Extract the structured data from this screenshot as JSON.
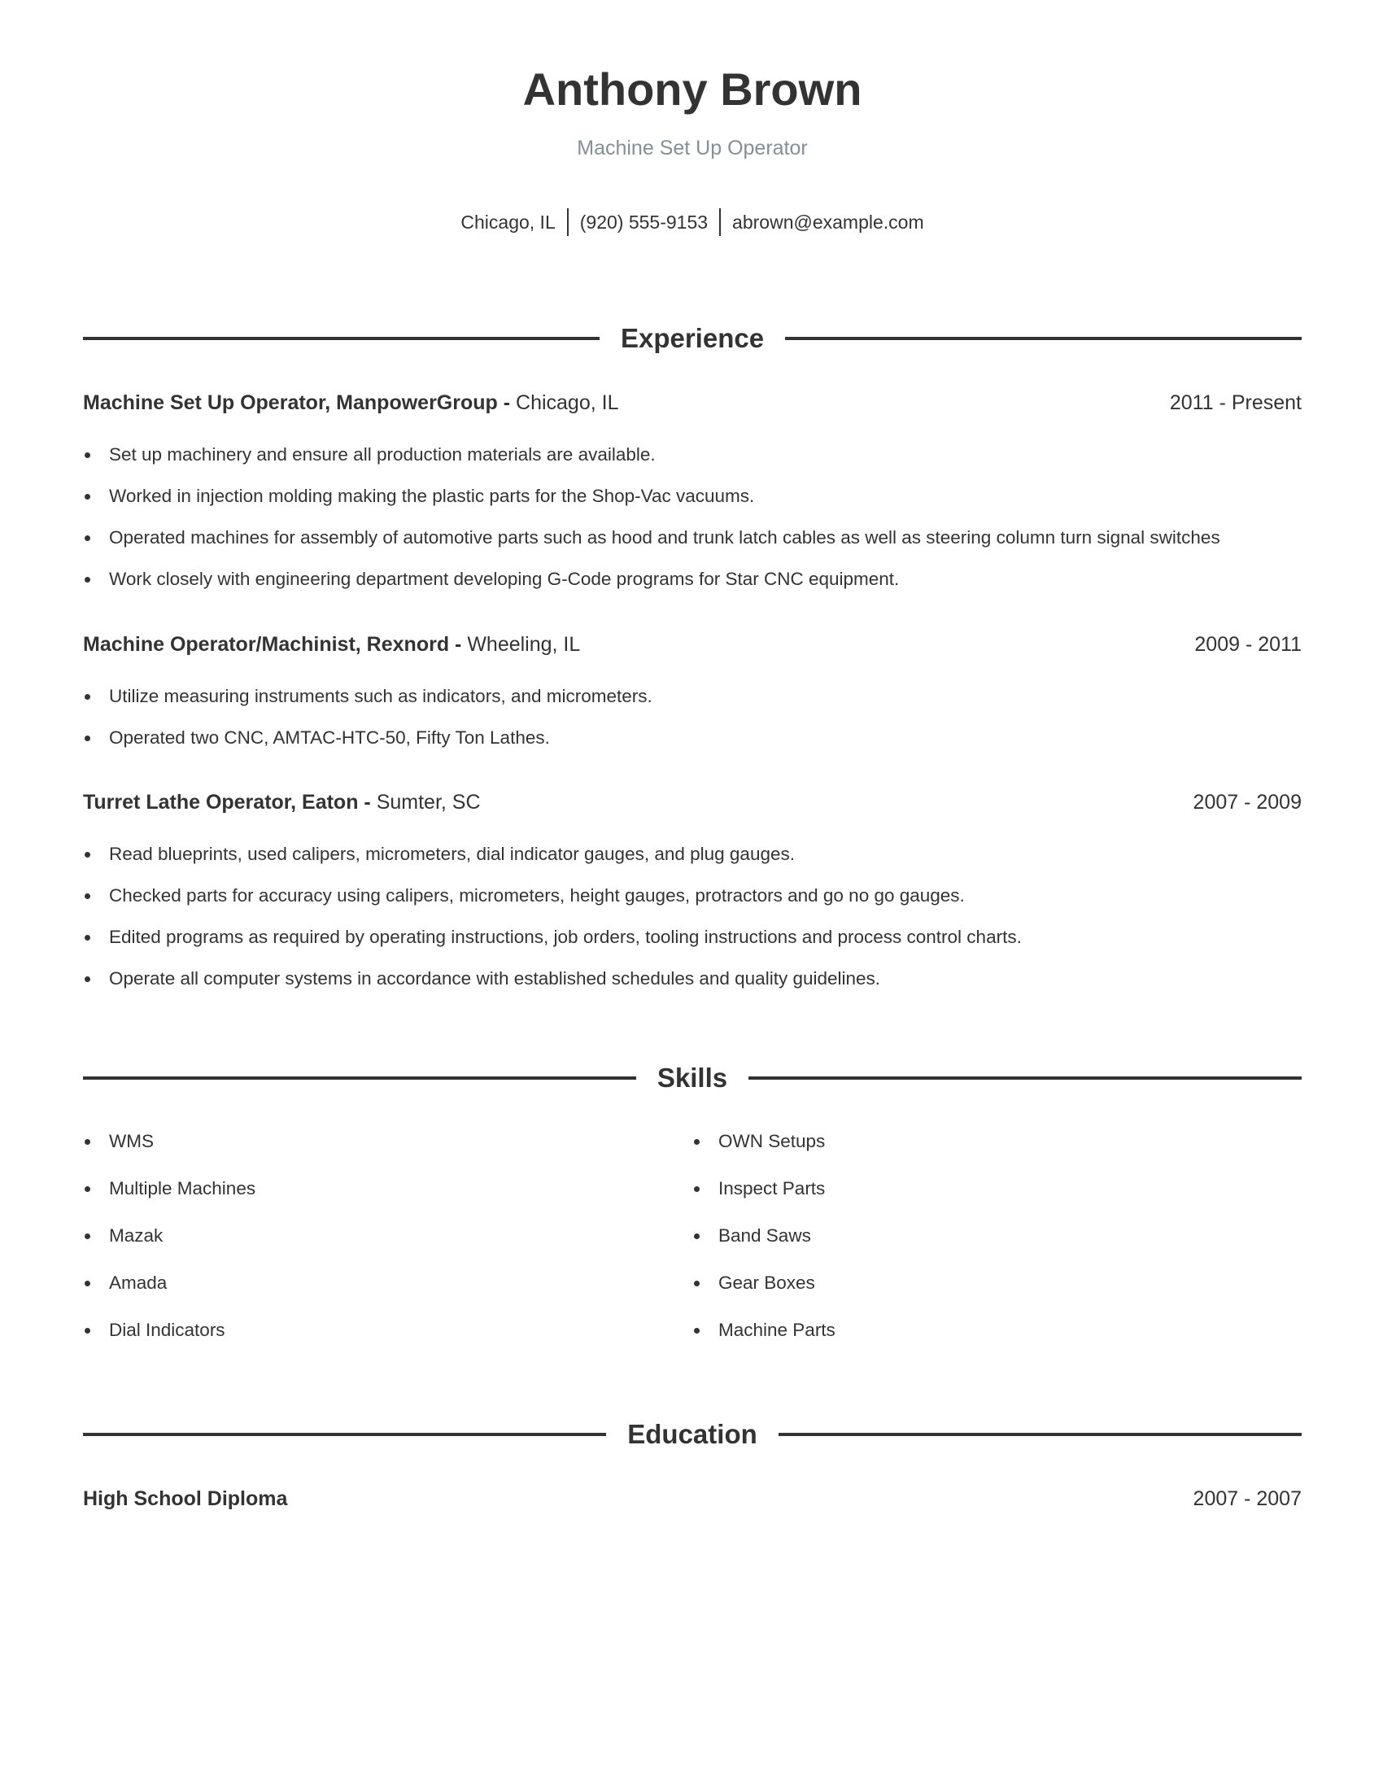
{
  "header": {
    "name": "Anthony Brown",
    "title": "Machine Set Up Operator",
    "contact": {
      "location": "Chicago, IL",
      "phone": "(920) 555-9153",
      "email": "abrown@example.com"
    }
  },
  "experience": {
    "heading": "Experience",
    "jobs": [
      {
        "role": "Machine Set Up Operator, ManpowerGroup -",
        "location": "Chicago, IL",
        "dates": "2011 - Present",
        "bullets": [
          "Set up machinery and ensure all production materials are available.",
          "Worked in injection molding making the plastic parts for the Shop-Vac vacuums.",
          "Operated machines for assembly of automotive parts such as hood and trunk latch cables as well as steering column turn signal switches",
          "Work closely with engineering department developing G-Code programs for Star CNC equipment."
        ]
      },
      {
        "role": "Machine Operator/Machinist, Rexnord -",
        "location": "Wheeling, IL",
        "dates": "2009 - 2011",
        "bullets": [
          "Utilize measuring instruments such as indicators, and micrometers.",
          "Operated two CNC, AMTAC-HTC-50, Fifty Ton Lathes."
        ]
      },
      {
        "role": "Turret Lathe Operator, Eaton -",
        "location": "Sumter, SC",
        "dates": "2007 - 2009",
        "bullets": [
          "Read blueprints, used calipers, micrometers, dial indicator gauges, and plug gauges.",
          "Checked parts for accuracy using calipers, micrometers, height gauges, protractors and go no go gauges.",
          "Edited programs as required by operating instructions, job orders, tooling instructions and process control charts.",
          "Operate all computer systems in accordance with established schedules and quality guidelines."
        ]
      }
    ]
  },
  "skills": {
    "heading": "Skills",
    "left": [
      "WMS",
      "Multiple Machines",
      "Mazak",
      "Amada",
      "Dial Indicators"
    ],
    "right": [
      "OWN Setups",
      "Inspect Parts",
      "Band Saws",
      "Gear Boxes",
      "Machine Parts"
    ]
  },
  "education": {
    "heading": "Education",
    "entries": [
      {
        "degree": "High School Diploma",
        "dates": "2007 - 2007"
      }
    ]
  },
  "colors": {
    "text": "#333333",
    "subtitle": "#868e96"
  }
}
